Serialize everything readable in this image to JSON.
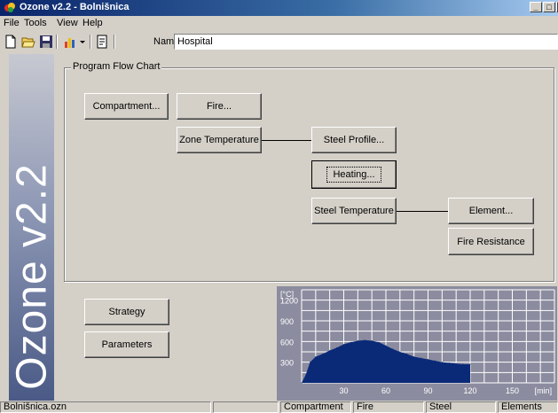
{
  "window": {
    "title": "Ozone v2.2 - Bolnišnica"
  },
  "menu": {
    "file": {
      "label": "File"
    },
    "tools": {
      "label": "Tools"
    },
    "view": {
      "label": "View"
    },
    "help": {
      "label": "Help"
    }
  },
  "toolbar": {
    "icons": [
      "new-file-icon",
      "open-folder-icon",
      "save-icon",
      "chart-icon",
      "dropdown-arrow-icon",
      "document-icon"
    ],
    "name_label": "Name:",
    "name_value": "Hospital"
  },
  "banner": {
    "text": "Ozone v2.2"
  },
  "flow_chart": {
    "legend": "Program Flow Chart",
    "compartment": "Compartment...",
    "fire": "Fire...",
    "zone_temperature": "Zone Temperature",
    "steel_profile": "Steel Profile...",
    "heating": "Heating...",
    "steel_temperature": "Steel Temperature",
    "element": "Element...",
    "fire_resistance": "Fire Resistance"
  },
  "bottom_buttons": {
    "strategy": "Strategy",
    "parameters": "Parameters"
  },
  "chart_data": {
    "type": "area",
    "title": "",
    "ylabel": "[°C]",
    "xlabel": "[min]",
    "y_ticks": [
      "1200",
      "900",
      "600",
      "300"
    ],
    "x_ticks": [
      "30",
      "60",
      "90",
      "120",
      "150",
      "[min]"
    ],
    "xlim": [
      0,
      180
    ],
    "ylim": [
      0,
      1350
    ],
    "grid": true,
    "colors": {
      "background": "#8c8ca0",
      "fill": "#0a2a78",
      "grid": "#ffffff",
      "text": "#ffffff"
    },
    "x": [
      0,
      3,
      6,
      10,
      15,
      20,
      25,
      30,
      35,
      40,
      45,
      50,
      55,
      60,
      65,
      70,
      75,
      80,
      85,
      90,
      95,
      100,
      105,
      110,
      115,
      120
    ],
    "values": [
      0,
      120,
      300,
      380,
      420,
      470,
      510,
      560,
      590,
      610,
      620,
      610,
      590,
      540,
      490,
      450,
      420,
      380,
      360,
      340,
      320,
      300,
      290,
      280,
      270,
      270
    ]
  },
  "status": {
    "file": "Bolnišnica.ozn",
    "panel2": "",
    "compartment": "Compartment",
    "fire": "Fire",
    "steel": "Steel",
    "elements": "Elements"
  }
}
